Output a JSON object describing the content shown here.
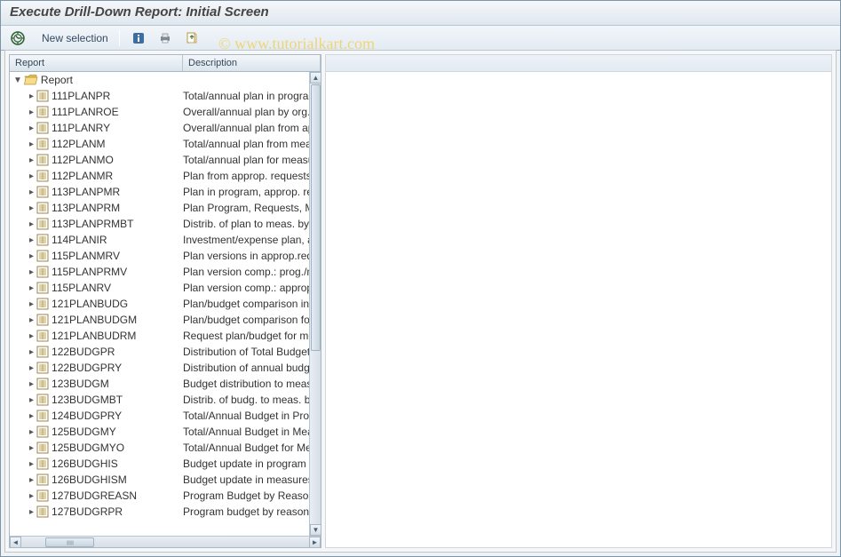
{
  "title": "Execute Drill-Down Report: Initial Screen",
  "watermark": "©  www.tutorialkart.com",
  "toolbar": {
    "new_selection": "New selection"
  },
  "tree": {
    "columns": {
      "report": "Report",
      "description": "Description"
    },
    "root_label": "Report",
    "items": [
      {
        "code": "111PLANPR",
        "desc": "Total/annual plan in program"
      },
      {
        "code": "111PLANROE",
        "desc": "Overall/annual plan by org. u"
      },
      {
        "code": "111PLANRY",
        "desc": "Overall/annual plan from app"
      },
      {
        "code": "112PLANM",
        "desc": "Total/annual plan from meas"
      },
      {
        "code": "112PLANMO",
        "desc": "Total/annual plan for measu"
      },
      {
        "code": "112PLANMR",
        "desc": "Plan from approp. requests "
      },
      {
        "code": "113PLANPMR",
        "desc": "Plan in program, approp. req"
      },
      {
        "code": "113PLANPRM",
        "desc": "Plan Program, Requests, Me"
      },
      {
        "code": "113PLANPRMBT",
        "desc": "Distrib. of plan to meas. by "
      },
      {
        "code": "114PLANIR",
        "desc": "Investment/expense plan, a"
      },
      {
        "code": "115PLANMRV",
        "desc": "Plan versions in approp.requ"
      },
      {
        "code": "115PLANPRMV",
        "desc": "Plan version comp.: prog./m"
      },
      {
        "code": "115PLANRV",
        "desc": "Plan version comp.: appropia"
      },
      {
        "code": "121PLANBUDG",
        "desc": "Plan/budget comparison in p"
      },
      {
        "code": "121PLANBUDGM",
        "desc": "Plan/budget comparison for "
      },
      {
        "code": "121PLANBUDRM",
        "desc": "Request plan/budget for me"
      },
      {
        "code": "122BUDGPR",
        "desc": "Distribution of Total Budget"
      },
      {
        "code": "122BUDGPRY",
        "desc": "Distribution of annual budge"
      },
      {
        "code": "123BUDGM",
        "desc": "Budget distribution to meas"
      },
      {
        "code": "123BUDGMBT",
        "desc": "Distrib. of budg. to meas. b"
      },
      {
        "code": "124BUDGPRY",
        "desc": "Total/Annual Budget in Prog"
      },
      {
        "code": "125BUDGMY",
        "desc": "Total/Annual Budget in Mea"
      },
      {
        "code": "125BUDGMYO",
        "desc": "Total/Annual Budget for Me"
      },
      {
        "code": "126BUDGHIS",
        "desc": "Budget update in program"
      },
      {
        "code": "126BUDGHISM",
        "desc": "Budget update in measures"
      },
      {
        "code": "127BUDGREASN",
        "desc": "Program Budget by Reason"
      },
      {
        "code": "127BUDGRPR",
        "desc": "Program budget by reason f"
      }
    ]
  }
}
